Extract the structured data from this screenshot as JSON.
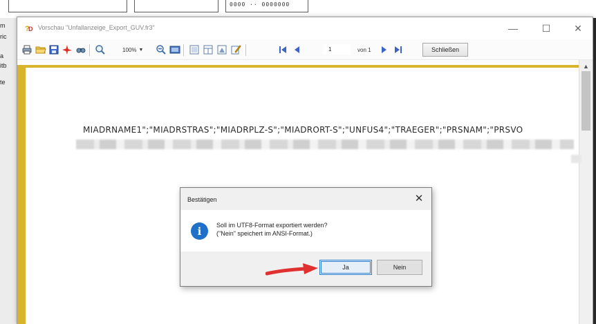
{
  "background": {
    "text_fragment": "0000 ·· 0000000",
    "left_fragments": [
      "m",
      "ric",
      "a",
      "itb",
      "te"
    ]
  },
  "window": {
    "title": "Vorschau \"Unfallanzeige_Export_GUV.fr3\"",
    "controls": {
      "minimize": "—",
      "maximize": "☐",
      "close": "✕"
    }
  },
  "toolbar": {
    "zoom_value": "100%",
    "zoom_dropdown": "▼",
    "page_value": "1",
    "page_of": "von 1",
    "close_preview_label": "Schließen"
  },
  "report": {
    "header_line": "MIADRNAME1\";\"MIADRSTRAS\";\"MIADRPLZ-S\";\"MIADRORT-S\";\"UNFUS4\";\"TRAEGER\";\"PRSNAM\";\"PRSVO"
  },
  "dialog": {
    "title": "Bestätigen",
    "close_glyph": "✕",
    "icon_glyph": "i",
    "message_line1": "Soll im UTF8-Format exportiert werden?",
    "message_line2": "(\"Nein\" speichert im ANSI-Format.)",
    "yes_label": "Ja",
    "no_label": "Nein"
  },
  "colors": {
    "accent_gold": "#d9b22e",
    "info_blue": "#1e70c8",
    "arrow_red": "#e03030",
    "focus_blue": "#2f7fd1"
  },
  "icons": [
    "app-logo-icon",
    "print-icon",
    "open-icon",
    "save-icon",
    "pdf-icon",
    "find-icon",
    "zoom-in-icon",
    "zoom-out-icon",
    "full-screen-icon",
    "page-setup-icon",
    "outline-icon",
    "thumbnails-icon",
    "edit-icon",
    "first-page-icon",
    "prev-page-icon",
    "next-page-icon",
    "last-page-icon",
    "info-icon",
    "red-arrow-icon"
  ]
}
